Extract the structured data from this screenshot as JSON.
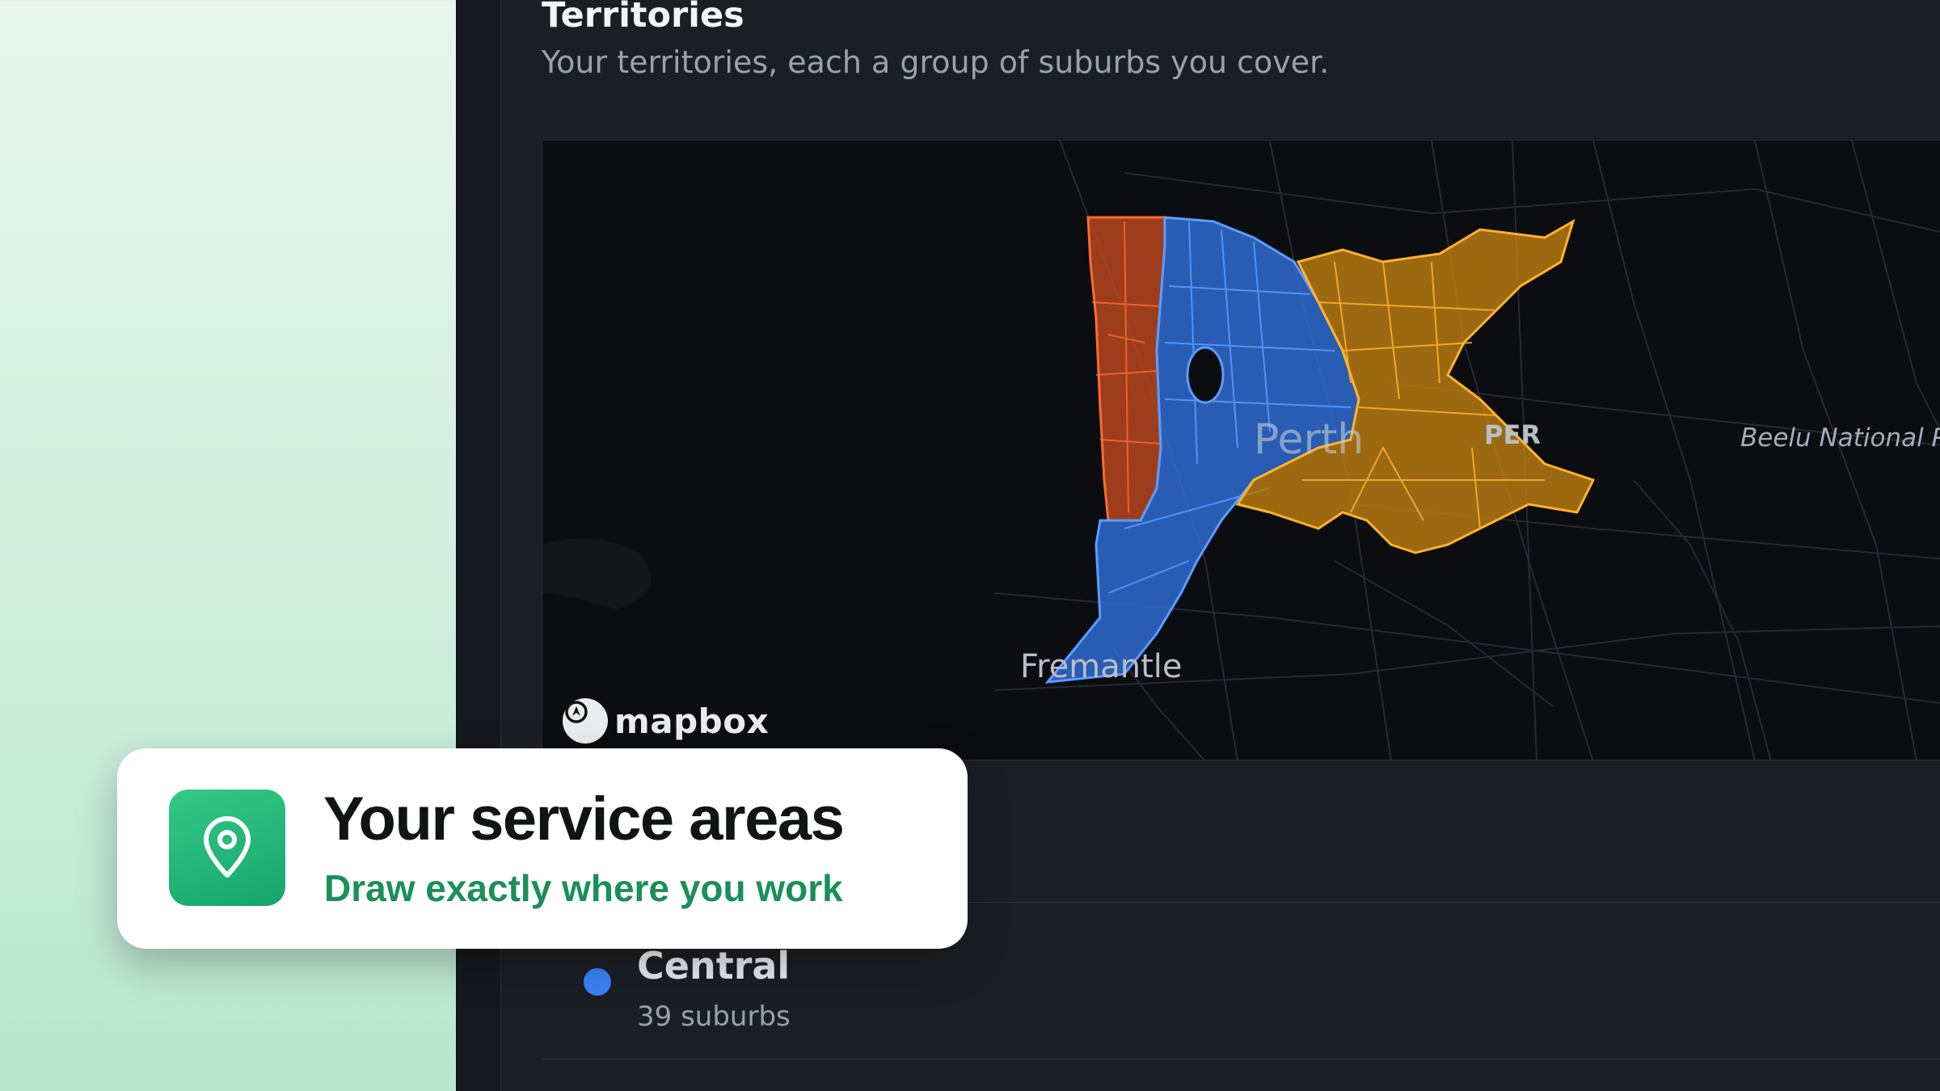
{
  "section": {
    "title": "Territories",
    "subtitle": "Your territories, each a group of suburbs you cover."
  },
  "map": {
    "labels": {
      "perth": "Perth",
      "airport": "PER",
      "park": "Beelu National P",
      "fremantle": "Fremantle"
    },
    "attribution": "mapbox",
    "territory_colors": {
      "orange": "#d0522a",
      "blue": "#3a7be0",
      "gold": "#e09a1e"
    }
  },
  "territories": [
    {
      "name": "Central",
      "count": "39 suburbs",
      "color": "#3b82f6"
    }
  ],
  "callout": {
    "title": "Your service areas",
    "subtitle": "Draw exactly where you work",
    "icon": "location-pin-icon",
    "accent": "#1a8f5a"
  }
}
